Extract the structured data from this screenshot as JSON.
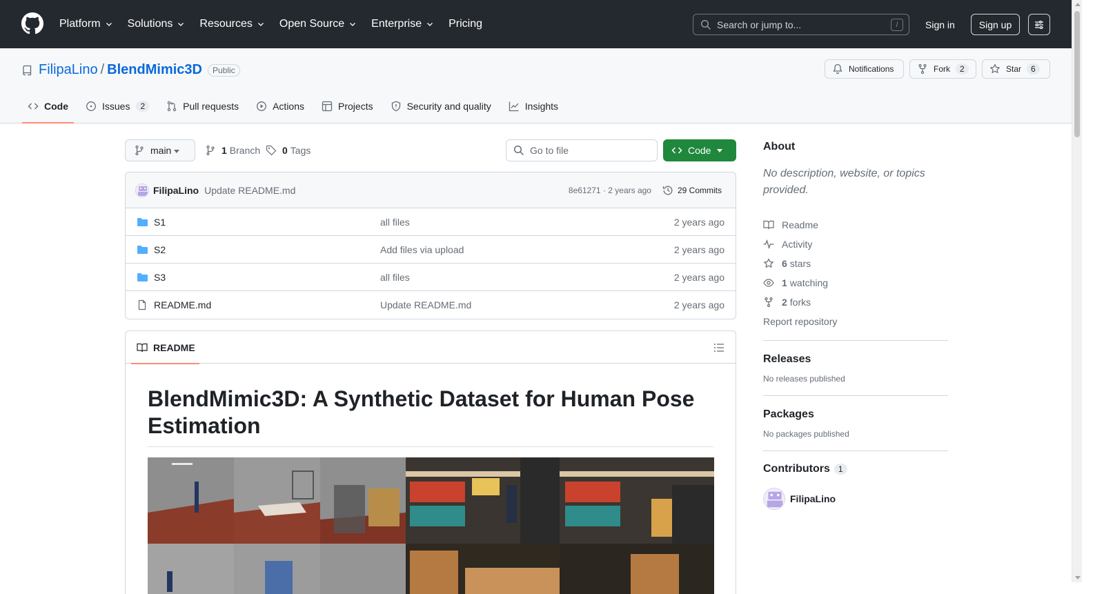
{
  "header": {
    "nav": [
      "Platform",
      "Solutions",
      "Resources",
      "Open Source",
      "Enterprise",
      "Pricing"
    ],
    "search_placeholder": "Search or jump to...",
    "search_shortcut": "/",
    "signin": "Sign in",
    "signup": "Sign up"
  },
  "repo": {
    "owner": "FilipaLino",
    "separator": "/",
    "name": "BlendMimic3D",
    "visibility": "Public",
    "notifications_label": "Notifications",
    "fork_label": "Fork",
    "fork_count": "2",
    "star_label": "Star",
    "star_count": "6"
  },
  "tabs": [
    {
      "label": "Code",
      "selected": true
    },
    {
      "label": "Issues",
      "count": "2"
    },
    {
      "label": "Pull requests"
    },
    {
      "label": "Actions"
    },
    {
      "label": "Projects"
    },
    {
      "label": "Security and quality"
    },
    {
      "label": "Insights"
    }
  ],
  "branchbar": {
    "branch": "main",
    "branch_count": "1",
    "branch_label": "Branch",
    "tag_count": "0",
    "tag_label": "Tags",
    "goto_placeholder": "Go to file",
    "code_label": "Code"
  },
  "commit": {
    "author": "FilipaLino",
    "message": "Update README.md",
    "hash_time": "8e61271 · 2 years ago",
    "commits_label": "29 Commits"
  },
  "files": [
    {
      "name": "S1",
      "type": "folder",
      "message": "all files",
      "date": "2 years ago"
    },
    {
      "name": "S2",
      "type": "folder",
      "message": "Add files via upload",
      "date": "2 years ago"
    },
    {
      "name": "S3",
      "type": "folder",
      "message": "all files",
      "date": "2 years ago"
    },
    {
      "name": "README.md",
      "type": "file",
      "message": "Update README.md",
      "date": "2 years ago"
    }
  ],
  "readme": {
    "tab_label": "README",
    "title": "BlendMimic3D: A Synthetic Dataset for Human Pose Estimation"
  },
  "sidebar": {
    "about_title": "About",
    "about_desc": "No description, website, or topics provided.",
    "readme": "Readme",
    "activity": "Activity",
    "stars_count": "6",
    "stars_label": "stars",
    "watching_count": "1",
    "watching_label": "watching",
    "forks_count": "2",
    "forks_label": "forks",
    "report": "Report repository",
    "releases_title": "Releases",
    "releases_text": "No releases published",
    "packages_title": "Packages",
    "packages_text": "No packages published",
    "contributors_title": "Contributors",
    "contributors_count": "1",
    "contributor_name": "FilipaLino"
  },
  "colors": {
    "header_bg": "#24292f",
    "link": "#0969da",
    "code_button": "#1f883d",
    "tab_underline": "#fd8c73"
  }
}
